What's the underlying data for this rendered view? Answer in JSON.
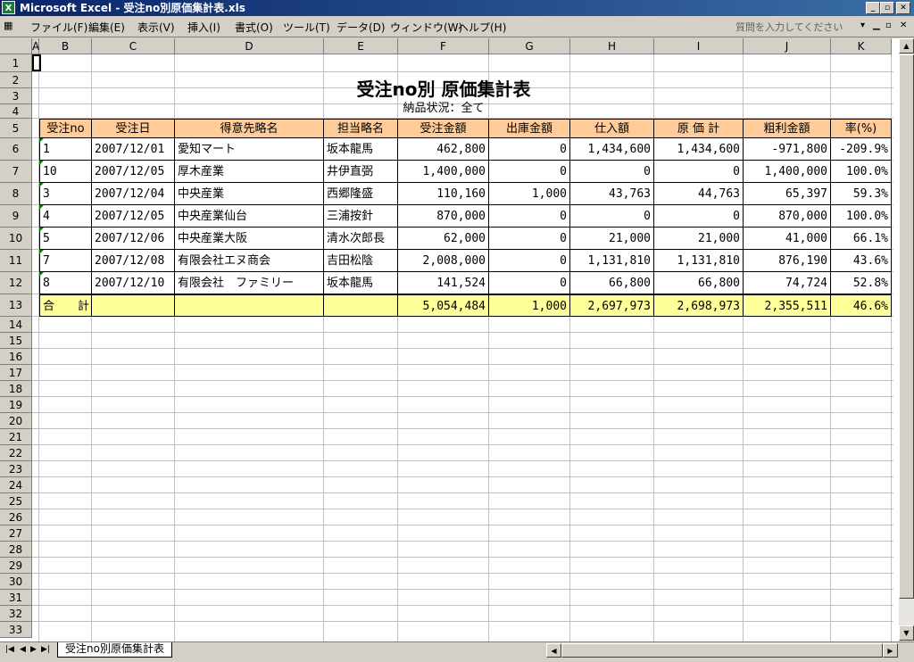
{
  "window": {
    "title": "Microsoft Excel - 受注no別原価集計表.xls",
    "app_icon": "excel-icon"
  },
  "menu": {
    "items": [
      "ファイル(F)",
      "編集(E)",
      "表示(V)",
      "挿入(I)",
      "書式(O)",
      "ツール(T)",
      "データ(D)",
      "ウィンドウ(W)",
      "ヘルプ(H)"
    ],
    "help_placeholder": "質問を入力してください"
  },
  "columns": [
    "A",
    "B",
    "C",
    "D",
    "E",
    "F",
    "G",
    "H",
    "I",
    "J",
    "K"
  ],
  "rows": [
    "1",
    "2",
    "3",
    "4",
    "5",
    "6",
    "7",
    "8",
    "9",
    "10",
    "11",
    "12",
    "13",
    "14",
    "15",
    "16",
    "17",
    "18",
    "19",
    "20",
    "21",
    "22",
    "23",
    "24",
    "25",
    "26",
    "27",
    "28",
    "29",
    "30",
    "31",
    "32",
    "33"
  ],
  "report": {
    "title": "受注no別 原価集計表",
    "subtitle": "納品状況：全て",
    "headers": [
      "受注no",
      "受注日",
      "得意先略名",
      "担当略名",
      "受注金額",
      "出庫金額",
      "仕入額",
      "原 価 計",
      "粗利金額",
      "率(%)"
    ],
    "data": [
      [
        "1",
        "2007/12/01",
        "愛知マート",
        "坂本龍馬",
        "462,800",
        "0",
        "1,434,600",
        "1,434,600",
        "-971,800",
        "-209.9%"
      ],
      [
        "10",
        "2007/12/05",
        "厚木産業",
        "井伊直弼",
        "1,400,000",
        "0",
        "0",
        "0",
        "1,400,000",
        "100.0%"
      ],
      [
        "3",
        "2007/12/04",
        "中央産業",
        "西郷隆盛",
        "110,160",
        "1,000",
        "43,763",
        "44,763",
        "65,397",
        "59.3%"
      ],
      [
        "4",
        "2007/12/05",
        "中央産業仙台",
        "三浦按針",
        "870,000",
        "0",
        "0",
        "0",
        "870,000",
        "100.0%"
      ],
      [
        "5",
        "2007/12/06",
        "中央産業大阪",
        "清水次郎長",
        "62,000",
        "0",
        "21,000",
        "21,000",
        "41,000",
        "66.1%"
      ],
      [
        "7",
        "2007/12/08",
        "有限会社エヌ商会",
        "吉田松陰",
        "2,008,000",
        "0",
        "1,131,810",
        "1,131,810",
        "876,190",
        "43.6%"
      ],
      [
        "8",
        "2007/12/10",
        "有限会社　ファミリー",
        "坂本龍馬",
        "141,524",
        "0",
        "66,800",
        "66,800",
        "74,724",
        "52.8%"
      ]
    ],
    "total": [
      "合　　計",
      "",
      "",
      "",
      "5,054,484",
      "1,000",
      "2,697,973",
      "2,698,973",
      "2,355,511",
      "46.6%"
    ]
  },
  "sheet_tab": "受注no別原価集計表"
}
